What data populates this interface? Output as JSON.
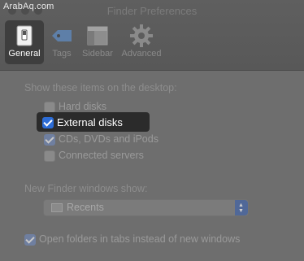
{
  "watermark": "ArabAq.com",
  "window": {
    "title": "Finder Preferences"
  },
  "toolbar": {
    "tabs": [
      {
        "label": "General",
        "icon": "general-switch-icon",
        "selected": true
      },
      {
        "label": "Tags",
        "icon": "tag-icon",
        "selected": false
      },
      {
        "label": "Sidebar",
        "icon": "sidebar-icon",
        "selected": false
      },
      {
        "label": "Advanced",
        "icon": "gear-icon",
        "selected": false
      }
    ]
  },
  "desktop_section": {
    "heading": "Show these items on the desktop:",
    "items": [
      {
        "label": "Hard disks",
        "checked": false
      },
      {
        "label": "External disks",
        "checked": true
      },
      {
        "label": "CDs, DVDs and iPods",
        "checked": true
      },
      {
        "label": "Connected servers",
        "checked": false
      }
    ]
  },
  "new_window_section": {
    "heading": "New Finder windows show:",
    "selected": "Recents"
  },
  "tabs_option": {
    "label": "Open folders in tabs instead of new windows",
    "checked": true
  },
  "colors": {
    "accent": "#2c6cd6",
    "window_bg": "#6e6e6e",
    "highlight": "#2b2b2b"
  }
}
